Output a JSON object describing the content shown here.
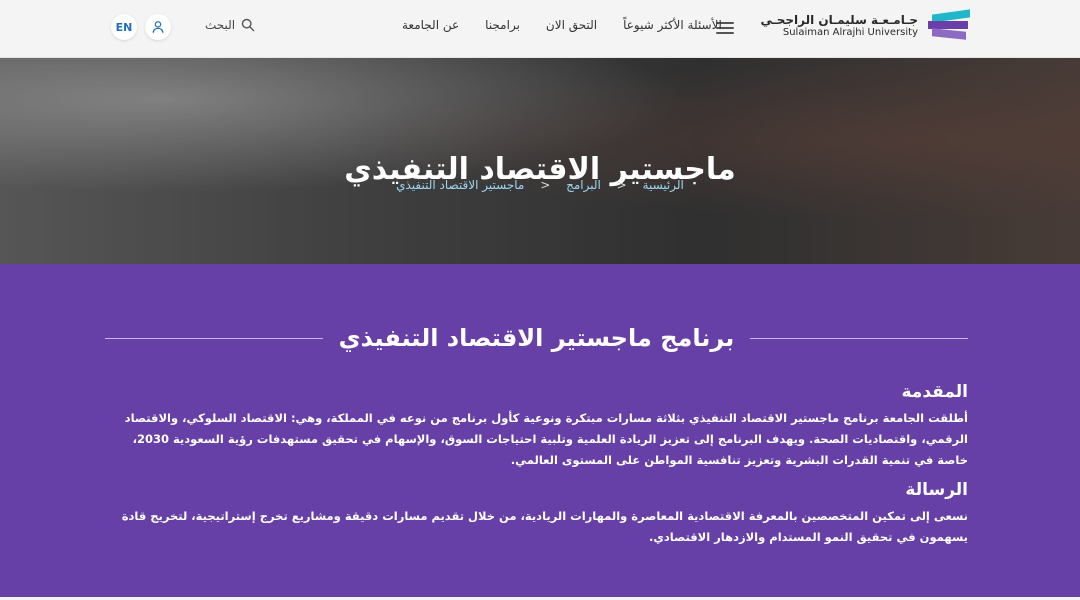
{
  "logo": {
    "arabic": "جـامـعـة سليمـان الراجحـي",
    "english": "Sulaiman Alrajhi University"
  },
  "nav": {
    "about": "عن الجامعة",
    "programs": "برامجنا",
    "apply": "التحق الان",
    "faq": "الأسئلة الأكثر شيوعاً"
  },
  "header": {
    "search_label": "البحث",
    "lang_label": "EN"
  },
  "hero": {
    "title": "ماجستير الاقتصاد التنفيذي",
    "breadcrumb": [
      "الرئيسية",
      "البرامج",
      "ماجستير الاقتصاد التنفيذي"
    ]
  },
  "content": {
    "section_title": "برنامج ماجستير الاقتصاد التنفيذي",
    "intro_heading": "المقدمة",
    "intro_text": "أطلقت الجامعة برنامج ماجستير الاقتصاد التنفيذي بثلاثة مسارات مبتكرة ونوعية كأول برنامج من نوعه في المملكة، وهي: الاقتصاد السلوكي، والاقتصاد الرقمي، واقتصاديات الصحة. ويهدف البرنامج إلى تعزيز الريادة العلمية وتلبية احتياجات السوق، والإسهام في تحقيق مستهدفات رؤية السعودية 2030، خاصة في تنمية القدرات البشرية وتعزيز تنافسية المواطن على المستوى العالمي.",
    "mission_heading": "الرسالة",
    "mission_text": "نسعى إلى تمكين المتخصصين بالمعرفة الاقتصادية المعاصرة والمهارات الريادية، من خلال تقديم مسارات دقيقة ومشاريع تخرج إستراتيجية، لتخريج قادة يسهمون في تحقيق النمو المستدام والازدهار الاقتصادي."
  },
  "colors": {
    "accent_purple": "#663fa7",
    "breadcrumb_link": "#9fd6f0",
    "lang_text": "#1e6fb8"
  }
}
